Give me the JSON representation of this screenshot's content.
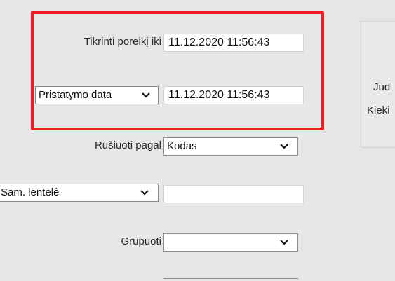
{
  "form": {
    "check_need_until": {
      "label": "Tikrinti poreikį iki",
      "value": "11.12.2020 11:56:43"
    },
    "date_type": {
      "selected": "Pristatymo data",
      "value": "11.12.2020 11:56:43"
    },
    "sort_by": {
      "label": "Rūšiuoti pagal",
      "selected": "Kodas"
    },
    "table": {
      "selected": "Sam. lentelė",
      "value": ""
    },
    "group_by": {
      "label": "Grupuoti",
      "selected": ""
    }
  },
  "side_panel": {
    "line1": "Jud",
    "line2": "Kieki"
  },
  "colors": {
    "highlight": "#ee1d23",
    "background": "#e7e7e7"
  }
}
